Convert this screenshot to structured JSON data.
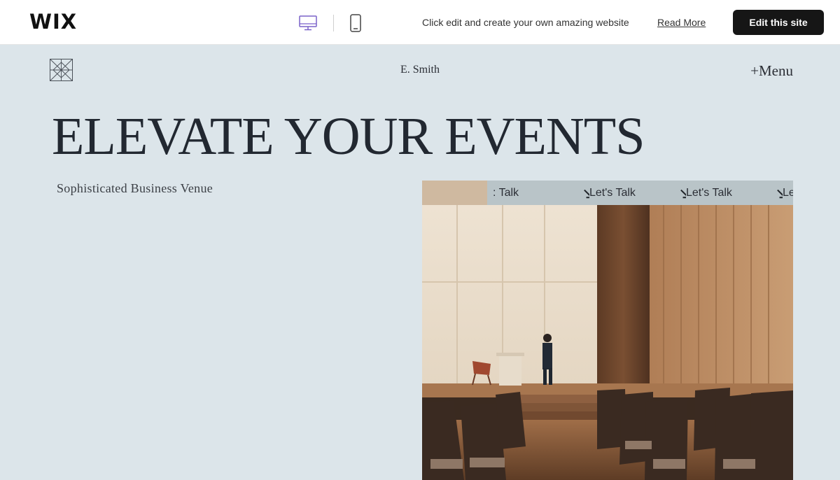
{
  "wix_bar": {
    "logo": "WIX",
    "promo_text": "Click edit and create your own amazing website",
    "read_more": "Read More",
    "edit_button": "Edit this site",
    "devices": [
      {
        "name": "desktop-icon",
        "active": true
      },
      {
        "name": "mobile-icon",
        "active": false
      }
    ]
  },
  "site": {
    "owner_name": "E. Smith",
    "menu_label": "+Menu",
    "hero_title": "ELEVATE YOUR EVENTS",
    "hero_subtitle": "Sophisticated Business Venue",
    "ticker": {
      "items": [
        ": Talk",
        "Let's Talk",
        "Let's Talk",
        "Let's"
      ],
      "arrow_icon": "arrow-down-right-icon"
    }
  },
  "colors": {
    "page_bg": "#dce5ea",
    "wix_bar_bg": "#ffffff",
    "edit_button_bg": "#161616",
    "ticker_bg": "#b9c4c8",
    "text_dark": "#222831",
    "device_active": "#7a62c9"
  }
}
